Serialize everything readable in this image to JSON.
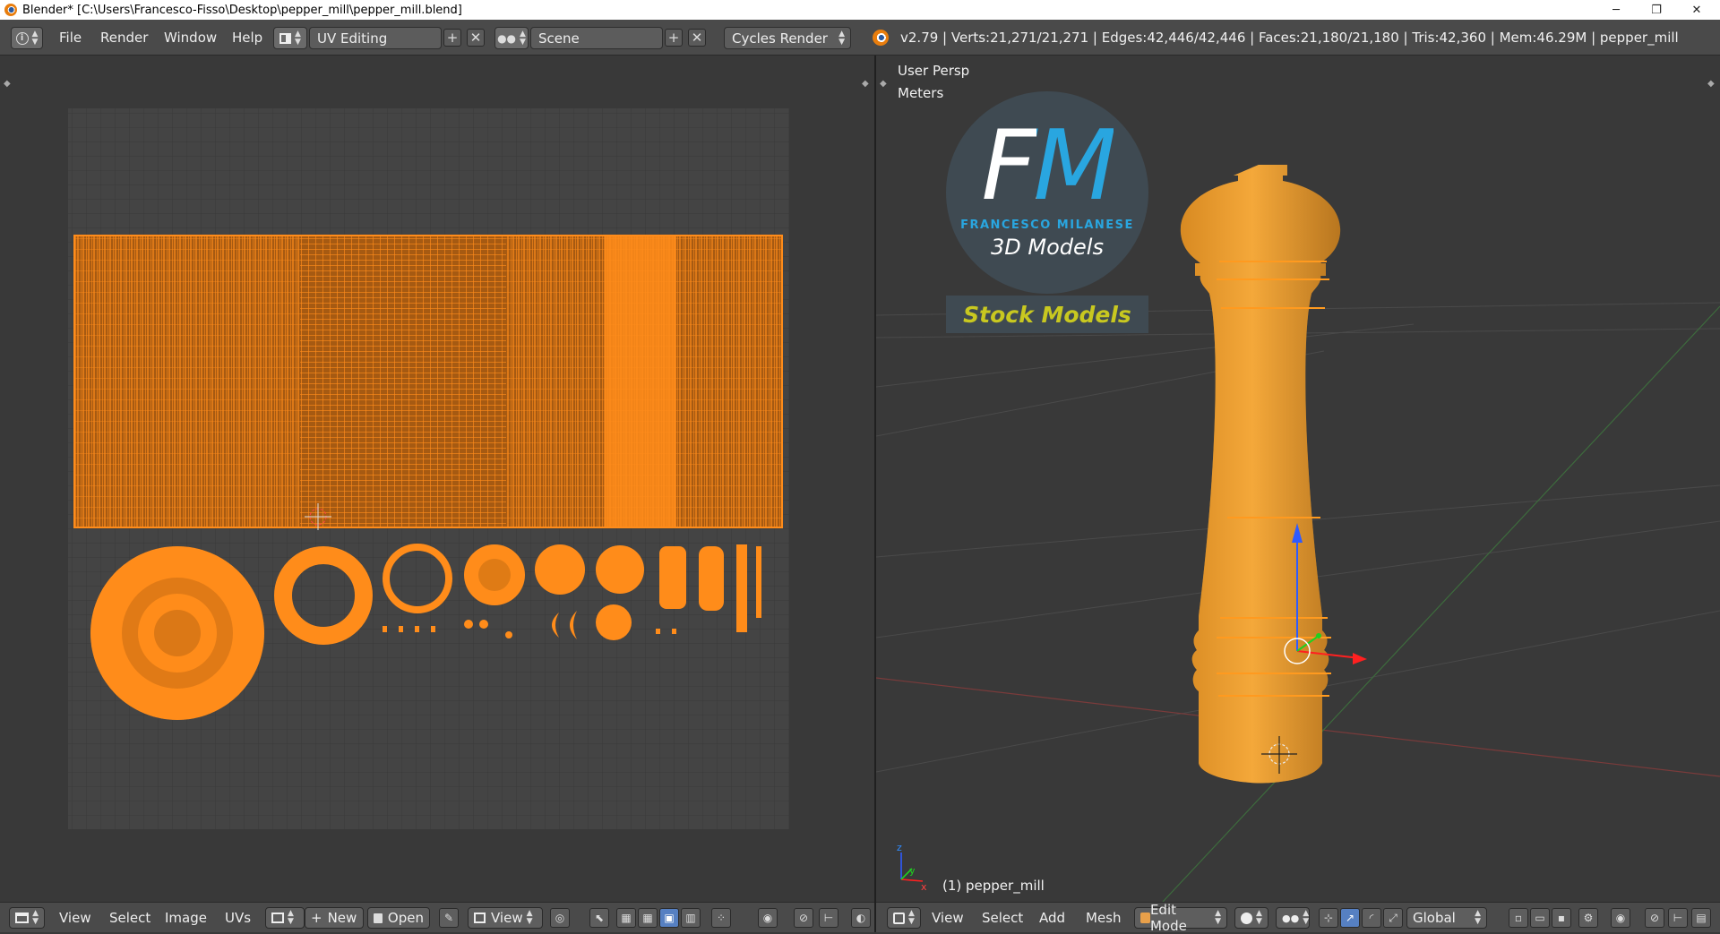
{
  "window": {
    "title": "Blender* [C:\\Users\\Francesco-Fisso\\Desktop\\pepper_mill\\pepper_mill.blend]",
    "minimize": "─",
    "maximize": "❐",
    "close": "✕"
  },
  "topbar": {
    "info_icon": "i",
    "menus": [
      "File",
      "Render",
      "Window",
      "Help"
    ],
    "layout": "UV Editing",
    "scene": "Scene",
    "engine": "Cycles Render",
    "stats": "v2.79 | Verts:21,271/21,271 | Edges:42,446/42,446 | Faces:21,180/21,180 | Tris:42,360 | Mem:46.29M | pepper_mill"
  },
  "viewport": {
    "view_name": "User Persp",
    "units": "Meters",
    "object_label": "(1) pepper_mill",
    "logo": {
      "letters": "FM",
      "company": "FRANCESCO MILANESE",
      "tagline": "3D Models",
      "banner": "Stock Models"
    }
  },
  "uv_bottombar": {
    "menus": [
      "View",
      "Select",
      "Image",
      "UVs"
    ],
    "new_label": "New",
    "open_label": "Open",
    "view_label": "View"
  },
  "view3d_bottombar": {
    "menus": [
      "View",
      "Select",
      "Add",
      "Mesh"
    ],
    "mode": "Edit Mode",
    "orientation": "Global"
  },
  "colors": {
    "uv_orange": "#ff8c1a",
    "background": "#393939",
    "header": "#4a4a4a",
    "logo_blue": "#29a6e0",
    "banner_yellow": "#c8c820"
  }
}
